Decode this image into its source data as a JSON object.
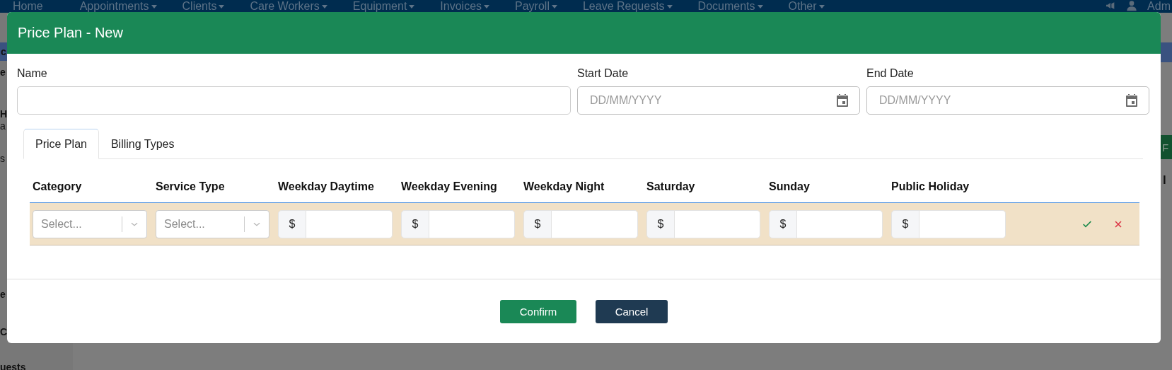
{
  "nav": {
    "items": [
      {
        "label": "Home",
        "dropdown": false
      },
      {
        "label": "Appointments",
        "dropdown": true
      },
      {
        "label": "Clients",
        "dropdown": true
      },
      {
        "label": "Care Workers",
        "dropdown": true
      },
      {
        "label": "Equipment",
        "dropdown": true
      },
      {
        "label": "Invoices",
        "dropdown": true
      },
      {
        "label": "Payroll",
        "dropdown": true
      },
      {
        "label": "Leave Requests",
        "dropdown": true
      },
      {
        "label": "Documents",
        "dropdown": true
      },
      {
        "label": "Other",
        "dropdown": true
      }
    ],
    "user": "Adm"
  },
  "sidebar_fragments": [
    {
      "text": "c",
      "kind": "header"
    },
    {
      "text": "e",
      "kind": "bold"
    },
    {
      "text": "H",
      "kind": "bold"
    },
    {
      "text": "a",
      "kind": "plain"
    },
    {
      "text": "s",
      "kind": "plain"
    },
    {
      "text": "e",
      "kind": "bold"
    },
    {
      "text": "C",
      "kind": "bold"
    },
    {
      "text": "uests",
      "kind": "bold"
    }
  ],
  "right_fragments": {
    "button": "F",
    "text": "l"
  },
  "modal": {
    "title": "Price Plan - New",
    "fields": [
      {
        "label": "Name",
        "kind": "text"
      },
      {
        "label": "Start Date",
        "kind": "date",
        "placeholder": "DD/MM/YYYY"
      },
      {
        "label": "End Date",
        "kind": "date",
        "placeholder": "DD/MM/YYYY"
      }
    ],
    "tabs": [
      {
        "label": "Price Plan",
        "selected": true
      },
      {
        "label": "Billing Types",
        "selected": false
      }
    ],
    "table": {
      "columns": [
        "Category",
        "Service Type",
        "Weekday Daytime",
        "Weekday Evening",
        "Weekday Night",
        "Saturday",
        "Sunday",
        "Public Holiday"
      ],
      "row": [
        {
          "kind": "select",
          "placeholder": "Select..."
        },
        {
          "kind": "select",
          "placeholder": "Select..."
        },
        {
          "kind": "currency",
          "prefix": "$"
        },
        {
          "kind": "currency",
          "prefix": "$"
        },
        {
          "kind": "currency",
          "prefix": "$"
        },
        {
          "kind": "currency",
          "prefix": "$"
        },
        {
          "kind": "currency",
          "prefix": "$"
        },
        {
          "kind": "currency",
          "prefix": "$"
        }
      ]
    },
    "buttons": [
      {
        "label": "Confirm",
        "kind": "primary"
      },
      {
        "label": "Cancel",
        "kind": "secondary"
      }
    ]
  }
}
